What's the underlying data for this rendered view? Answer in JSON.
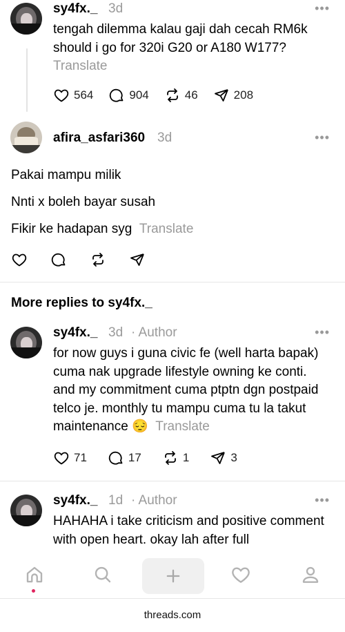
{
  "posts": [
    {
      "username": "sy4fx._",
      "time": "3d",
      "author_tag": "",
      "lines": [
        "tengah dilemma kalau gaji dah cecah RM6k",
        "should i go for 320i G20 or A180 W177?"
      ],
      "translate": "Translate",
      "counts": {
        "likes": "564",
        "replies": "904",
        "reposts": "46",
        "shares": "208"
      }
    },
    {
      "username": "afira_asfari360",
      "time": "3d",
      "lines": [
        "Pakai mampu milik",
        "Nnti x boleh bayar susah",
        "Fikir ke hadapan syg"
      ],
      "translate": "Translate"
    },
    {
      "username": "sy4fx._",
      "time": "3d",
      "author_tag": "· Author",
      "lines": [
        "for now guys i guna civic fe (well harta bapak)",
        "cuma nak upgrade lifestyle owning ke conti.",
        "and my commitment cuma ptptn dgn postpaid",
        "telco je. monthly tu mampu cuma tu la takut",
        "maintenance 😔"
      ],
      "translate": "Translate",
      "counts": {
        "likes": "71",
        "replies": "17",
        "reposts": "1",
        "shares": "3"
      }
    },
    {
      "username": "sy4fx._",
      "time": "1d",
      "author_tag": "· Author",
      "lines": [
        "HAHAHA i take criticism and positive comment",
        "with open heart. okay lah after full"
      ]
    }
  ],
  "more_replies_title": "More replies to sy4fx._",
  "more_icon": "•••",
  "footer_domain": "threads.com",
  "colors": {
    "muted": "#9a9a9a",
    "divider": "#e6e6e6",
    "notify_dot": "#e0245e"
  }
}
